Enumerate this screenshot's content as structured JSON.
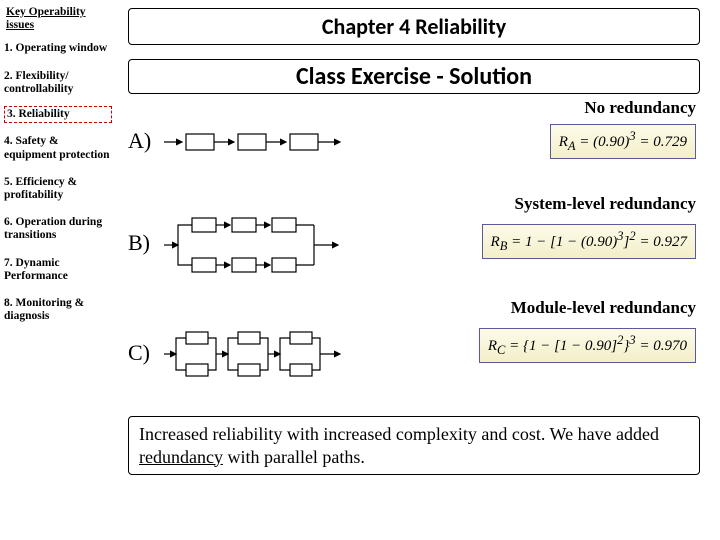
{
  "sidebar": {
    "header": "Key Operability issues",
    "items": [
      "1. Operating window",
      "2. Flexibility/ controllability",
      "3. Reliability",
      "4. Safety & equipment protection",
      "5. Efficiency & profitability",
      "6. Operation during transitions",
      "7. Dynamic Performance",
      "8. Monitoring & diagnosis"
    ],
    "current_index": 2
  },
  "title": "Chapter 4 Reliability",
  "subtitle": "Class Exercise - Solution",
  "rows": {
    "A": {
      "label": "A)",
      "desc": "No redundancy",
      "formula_html": "R<sub>A</sub> = (0.90)<sup>3</sup> = 0.729"
    },
    "B": {
      "label": "B)",
      "desc": "System-level redundancy",
      "formula_html": "R<sub>B</sub> = 1 − [1 − (0.90)<sup>3</sup>]<sup>2</sup> = 0.927"
    },
    "C": {
      "label": "C)",
      "desc": "Module-level redundancy",
      "formula_html": "R<sub>C</sub> = {1 − [1 − 0.90]<sup>2</sup>}<sup>3</sup> = 0.970"
    }
  },
  "footer": {
    "pre": "Increased reliability with increased complexity and cost.  We have added ",
    "u": "redundancy",
    "post": " with parallel paths."
  }
}
